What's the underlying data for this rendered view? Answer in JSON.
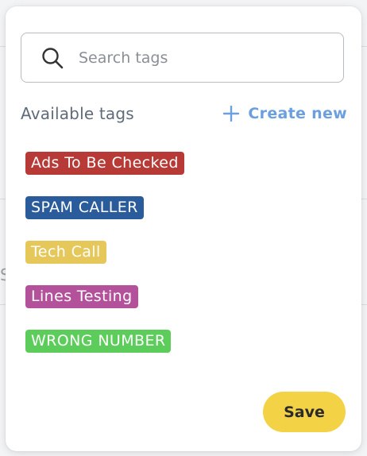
{
  "search": {
    "placeholder": "Search tags",
    "value": "",
    "icon": "search-icon"
  },
  "section": {
    "title": "Available tags",
    "create_label": "Create new",
    "create_icon": "plus-icon"
  },
  "tags": [
    {
      "label": "Ads To Be Checked",
      "color": "#b83a36"
    },
    {
      "label": "SPAM CALLER",
      "color": "#2a5b9a"
    },
    {
      "label": "Tech Call",
      "color": "#e6c75a"
    },
    {
      "label": "Lines Testing",
      "color": "#b3519b"
    },
    {
      "label": "WRONG NUMBER",
      "color": "#5ccd5a"
    }
  ],
  "footer": {
    "save_label": "Save",
    "save_color": "#f4d246"
  },
  "colors": {
    "accent": "#6b9fe0",
    "muted_text": "#5f6b7a"
  }
}
